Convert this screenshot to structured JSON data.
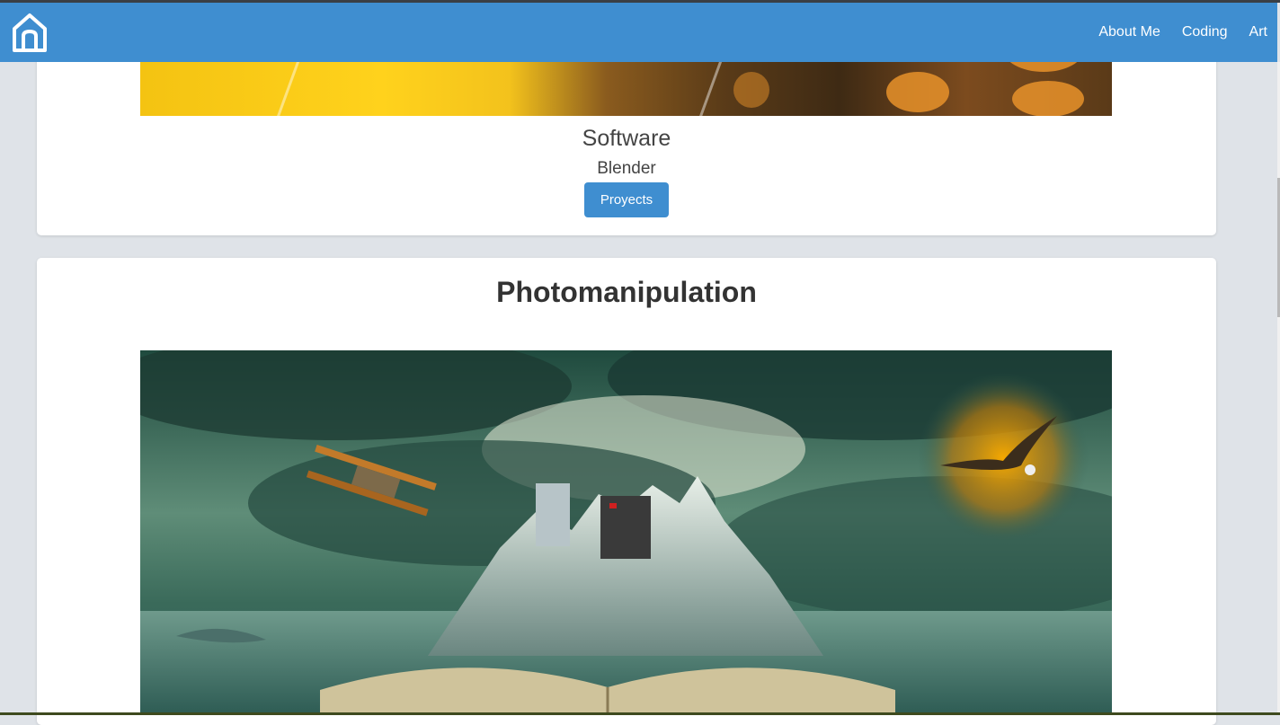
{
  "navbar": {
    "home_icon": "home-icon",
    "links": [
      {
        "label": "About Me"
      },
      {
        "label": "Coding"
      },
      {
        "label": "Art"
      }
    ],
    "color": "#3f8ed0"
  },
  "software_card": {
    "title": "Software",
    "subtitle": "Blender",
    "button_label": "Proyects"
  },
  "photo_card": {
    "title": "Photomanipulation"
  },
  "colors": {
    "accent": "#3f8ed0",
    "background": "#dfe3e8",
    "card": "#ffffff"
  }
}
